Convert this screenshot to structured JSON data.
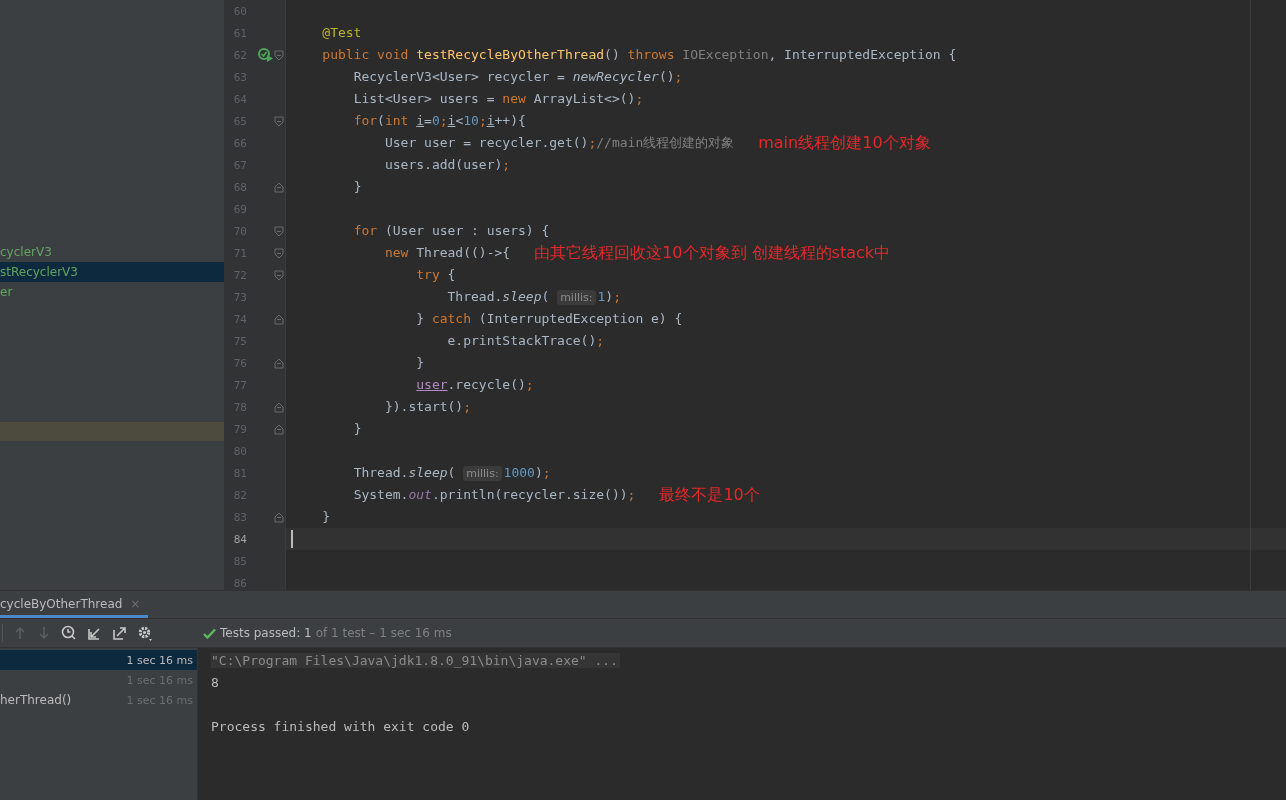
{
  "project_tree": {
    "items": [
      {
        "label": "cyclerV3",
        "selected": false
      },
      {
        "label": "stRecyclerV3",
        "selected": true
      },
      {
        "label": "er",
        "selected": false
      }
    ]
  },
  "editor": {
    "lines": [
      {
        "number": "60"
      },
      {
        "number": "61",
        "tokens": [
          {
            "kind": "ann",
            "text": "    @Test"
          }
        ]
      },
      {
        "number": "62",
        "run": true,
        "fold_start": true,
        "tokens": [
          {
            "kind": "kw",
            "text": "    public void "
          },
          {
            "kind": "fn",
            "text": "testRecycleByOtherThread"
          },
          {
            "kind": "plain",
            "text": "() "
          },
          {
            "kind": "kw",
            "text": "throws "
          },
          {
            "kind": "dim",
            "text": "IOException"
          },
          {
            "kind": "plain",
            "text": ", InterruptedException {"
          }
        ]
      },
      {
        "number": "63",
        "tokens": [
          {
            "kind": "plain",
            "text": "        RecyclerV3<User> recycler = "
          },
          {
            "kind": "it",
            "text": "newRecycler"
          },
          {
            "kind": "plain",
            "text": "()"
          },
          {
            "kind": "kw",
            "text": ";"
          }
        ]
      },
      {
        "number": "64",
        "tokens": [
          {
            "kind": "plain",
            "text": "        List<User> users = "
          },
          {
            "kind": "kw",
            "text": "new "
          },
          {
            "kind": "plain",
            "text": "ArrayList<>()"
          },
          {
            "kind": "kw",
            "text": ";"
          }
        ]
      },
      {
        "number": "65",
        "fold_start": true,
        "tokens": [
          {
            "kind": "kw",
            "text": "        for"
          },
          {
            "kind": "plain",
            "text": "("
          },
          {
            "kind": "kw",
            "text": "int "
          },
          {
            "kind": "u",
            "text": "i"
          },
          {
            "kind": "plain",
            "text": "="
          },
          {
            "kind": "num",
            "text": "0"
          },
          {
            "kind": "kw",
            "text": ";"
          },
          {
            "kind": "u",
            "text": "i"
          },
          {
            "kind": "plain",
            "text": "<"
          },
          {
            "kind": "num",
            "text": "10"
          },
          {
            "kind": "kw",
            "text": ";"
          },
          {
            "kind": "u",
            "text": "i"
          },
          {
            "kind": "plain",
            "text": "++){"
          }
        ]
      },
      {
        "number": "66",
        "note": "main线程创建10个对象",
        "tokens": [
          {
            "kind": "plain",
            "text": "            User user = recycler.get()"
          },
          {
            "kind": "kw",
            "text": ";"
          },
          {
            "kind": "cmt",
            "text": "//main线程创建的对象"
          }
        ]
      },
      {
        "number": "67",
        "tokens": [
          {
            "kind": "plain",
            "text": "            users.add(user)"
          },
          {
            "kind": "kw",
            "text": ";"
          }
        ]
      },
      {
        "number": "68",
        "fold_end": true,
        "tokens": [
          {
            "kind": "plain",
            "text": "        }"
          }
        ]
      },
      {
        "number": "69"
      },
      {
        "number": "70",
        "fold_start": true,
        "tokens": [
          {
            "kind": "kw",
            "text": "        for "
          },
          {
            "kind": "plain",
            "text": "(User user : users) {"
          }
        ]
      },
      {
        "number": "71",
        "fold_start": true,
        "note": "由其它线程回收这10个对象到 创建线程的stack中",
        "tokens": [
          {
            "kind": "kw",
            "text": "            new "
          },
          {
            "kind": "plain",
            "text": "Thread(()->{"
          }
        ]
      },
      {
        "number": "72",
        "fold_start": true,
        "tokens": [
          {
            "kind": "kw",
            "text": "                try "
          },
          {
            "kind": "plain",
            "text": "{"
          }
        ]
      },
      {
        "number": "73",
        "tokens": [
          {
            "kind": "plain",
            "text": "                    Thread."
          },
          {
            "kind": "it",
            "text": "sleep"
          },
          {
            "kind": "plain",
            "text": "( "
          },
          {
            "kind": "hint",
            "text": "millis:"
          },
          {
            "kind": "num",
            "text": "1"
          },
          {
            "kind": "plain",
            "text": ")"
          },
          {
            "kind": "kw",
            "text": ";"
          }
        ]
      },
      {
        "number": "74",
        "fold_end": true,
        "tokens": [
          {
            "kind": "plain",
            "text": "                } "
          },
          {
            "kind": "kw",
            "text": "catch "
          },
          {
            "kind": "plain",
            "text": "(InterruptedException e) {"
          }
        ]
      },
      {
        "number": "75",
        "tokens": [
          {
            "kind": "plain",
            "text": "                    e.printStackTrace()"
          },
          {
            "kind": "kw",
            "text": ";"
          }
        ]
      },
      {
        "number": "76",
        "fold_end": true,
        "tokens": [
          {
            "kind": "plain",
            "text": "                }"
          }
        ]
      },
      {
        "number": "77",
        "tokens": [
          {
            "kind": "uvar",
            "text": "                user"
          },
          {
            "kind": "plain",
            "text": ".recycle()"
          },
          {
            "kind": "kw",
            "text": ";"
          }
        ]
      },
      {
        "number": "78",
        "fold_end": true,
        "tokens": [
          {
            "kind": "plain",
            "text": "            }).start()"
          },
          {
            "kind": "kw",
            "text": ";"
          }
        ]
      },
      {
        "number": "79",
        "fold_end": true,
        "tokens": [
          {
            "kind": "plain",
            "text": "        }"
          }
        ]
      },
      {
        "number": "80"
      },
      {
        "number": "81",
        "tokens": [
          {
            "kind": "plain",
            "text": "        Thread."
          },
          {
            "kind": "it",
            "text": "sleep"
          },
          {
            "kind": "plain",
            "text": "( "
          },
          {
            "kind": "hint",
            "text": "millis:"
          },
          {
            "kind": "num",
            "text": "1000"
          },
          {
            "kind": "plain",
            "text": ")"
          },
          {
            "kind": "kw",
            "text": ";"
          }
        ]
      },
      {
        "number": "82",
        "note": "最终不是10个",
        "tokens": [
          {
            "kind": "plain",
            "text": "        System."
          },
          {
            "kind": "field",
            "text": "out"
          },
          {
            "kind": "plain",
            "text": ".println(recycler.size())"
          },
          {
            "kind": "kw",
            "text": ";"
          }
        ]
      },
      {
        "number": "83",
        "fold_end": true,
        "tokens": [
          {
            "kind": "plain",
            "text": "    }"
          }
        ]
      },
      {
        "number": "84",
        "current": true
      },
      {
        "number": "85"
      },
      {
        "number": "86"
      }
    ]
  },
  "run_panel": {
    "tab": {
      "label": "cycleByOtherThread",
      "close": "×"
    },
    "status": {
      "passed": "Tests passed: 1",
      "detail": "of 1 test – 1 sec 16 ms"
    },
    "tests": [
      {
        "time": "1 sec 16 ms",
        "selected": true
      },
      {
        "time": "1 sec 16 ms",
        "selected": false
      },
      {
        "label": "herThread()",
        "time": "1 sec 16 ms",
        "selected": false
      }
    ],
    "console": [
      {
        "kind": "command",
        "text": "\"C:\\Program Files\\Java\\jdk1.8.0_91\\bin\\java.exe\" ..."
      },
      {
        "kind": "output",
        "text": "8"
      },
      {
        "kind": "exit",
        "text": "Process finished with exit code 0"
      }
    ]
  }
}
